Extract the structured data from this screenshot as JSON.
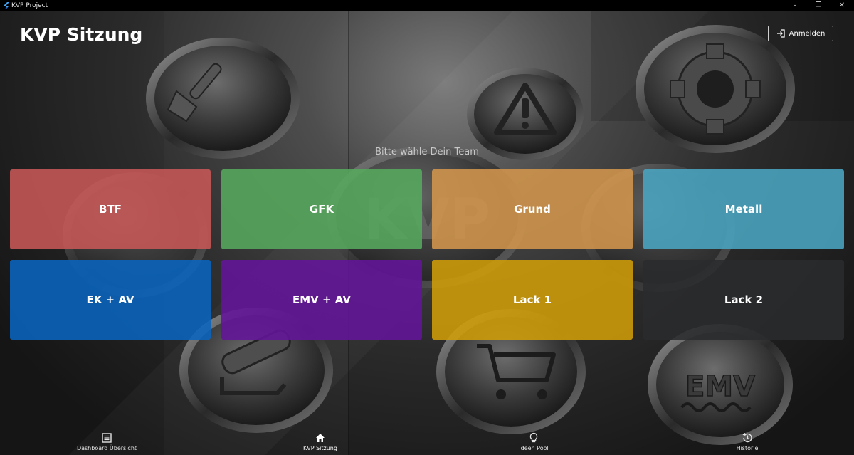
{
  "window": {
    "title": "KVP Project",
    "controls": [
      "minimize",
      "restore",
      "close"
    ]
  },
  "header": {
    "title": "KVP Sitzung",
    "login_label": "Anmelden"
  },
  "prompt": "Bitte wähle Dein Team",
  "teams": [
    {
      "label": "BTF",
      "color": "#c75656"
    },
    {
      "label": "GFK",
      "color": "#56a95c"
    },
    {
      "label": "Grund",
      "color": "#d3964c"
    },
    {
      "label": "Metall",
      "color": "#4aa5c1"
    },
    {
      "label": "EK + AV",
      "color": "#0a64bf"
    },
    {
      "label": "EMV + AV",
      "color": "#64149a"
    },
    {
      "label": "Lack 1",
      "color": "#cf9d08"
    },
    {
      "label": "Lack 2",
      "color": "#2a2b2d"
    }
  ],
  "background_icons": [
    "brush-icon",
    "warning-icon",
    "gear-icon",
    "kvp-logo",
    "box-icon",
    "roller-icon",
    "cart-icon",
    "emv-logo"
  ],
  "background_labels": {
    "kvp": "KVP",
    "emv": "EMV"
  },
  "bottom_nav": [
    {
      "label": "Dashboard Übersicht",
      "icon": "list-icon"
    },
    {
      "label": "KVP Sitzung",
      "icon": "home-icon",
      "active": true
    },
    {
      "label": "Ideen Pool",
      "icon": "lightbulb-icon"
    },
    {
      "label": "Historie",
      "icon": "history-icon"
    }
  ]
}
